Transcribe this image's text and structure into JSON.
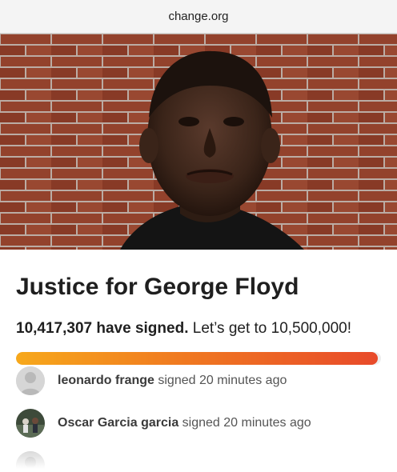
{
  "browser": {
    "url": "change.org"
  },
  "petition": {
    "title": "Justice for George Floyd",
    "signed_count": "10,417,307 have signed.",
    "goal_text": "Let’s get to 10,500,000!",
    "progress_fraction": 0.992
  },
  "recent_signers": [
    {
      "name": "leonardo frange",
      "action": "signed 20 minutes ago",
      "avatar": "default-avatar-icon"
    },
    {
      "name": "Oscar Garcia garcia",
      "action": "signed 20 minutes ago",
      "avatar": "photo"
    },
    {
      "name": "",
      "action": "",
      "avatar": "default-avatar-icon"
    }
  ],
  "colors": {
    "progress_start": "#f7a81b",
    "progress_end": "#e84a2a",
    "brick": "#8a3e2a"
  }
}
